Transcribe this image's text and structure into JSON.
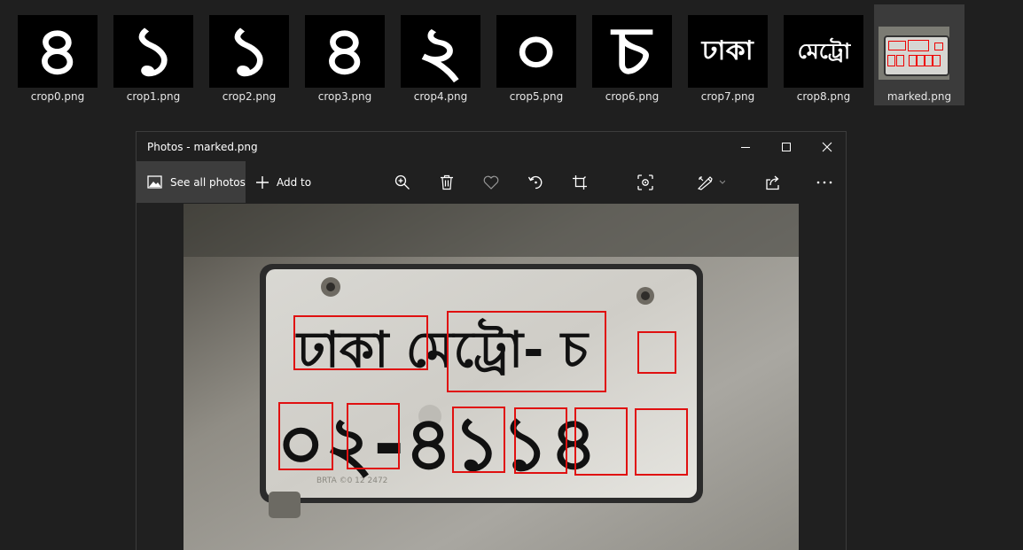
{
  "explorer": {
    "thumbnails": [
      {
        "file": "crop0.png",
        "glyph": "৪"
      },
      {
        "file": "crop1.png",
        "glyph": "১"
      },
      {
        "file": "crop2.png",
        "glyph": "১"
      },
      {
        "file": "crop3.png",
        "glyph": "৪"
      },
      {
        "file": "crop4.png",
        "glyph": "২"
      },
      {
        "file": "crop5.png",
        "glyph": "০"
      },
      {
        "file": "crop6.png",
        "glyph": "চ"
      },
      {
        "file": "crop7.png",
        "glyph": "ঢাকা"
      },
      {
        "file": "crop8.png",
        "glyph": "মেট্রো"
      },
      {
        "file": "marked.png",
        "glyph": "ঢাকা মেট্রো-চ ০২-৪১১৪"
      }
    ]
  },
  "window": {
    "title": "Photos - marked.png",
    "controls": {
      "minimize": "minimize-icon",
      "maximize": "maximize-icon",
      "close": "close-icon"
    }
  },
  "toolbar": {
    "see_all": "See all photos",
    "add_to": "Add to",
    "icons": [
      "zoom-in-icon",
      "delete-icon",
      "favorite-icon",
      "rotate-icon",
      "crop-icon",
      "visual-search-icon",
      "edit-icon",
      "share-icon",
      "more-icon"
    ]
  },
  "photo": {
    "plate_line1": "ঢাকা মেট্রো- চ",
    "plate_line2": "০২-৪১১৪",
    "detections": [
      "ঢাকা",
      "মেট্রো",
      "চ",
      "০",
      "২",
      "৪",
      "১",
      "১",
      "৪"
    ],
    "box_color": "#e01010",
    "emboss_text": "BRTA ©0 12 2472"
  }
}
